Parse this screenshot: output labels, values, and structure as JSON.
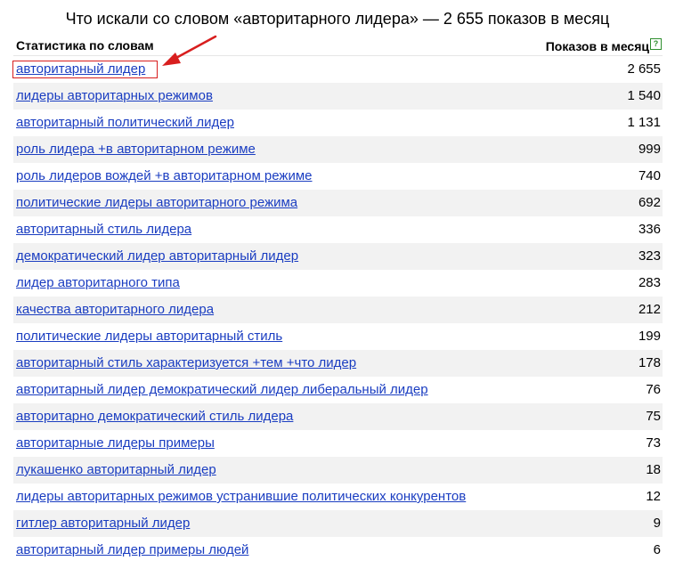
{
  "page": {
    "title": "Что искали со словом «авторитарного лидера» — 2 655 показов в месяц"
  },
  "table": {
    "keyword_header": "Статистика по словам",
    "count_header": "Показов в месяц",
    "help_icon_glyph": "?",
    "help_icon_name": "help-icon",
    "link_color": "#1a3dc1",
    "stripe_color": "#f2f2f2",
    "rows": [
      {
        "keyword": "авторитарный лидер",
        "count": "2 655"
      },
      {
        "keyword": "лидеры авторитарных режимов",
        "count": "1 540"
      },
      {
        "keyword": "авторитарный политический лидер",
        "count": "1 131"
      },
      {
        "keyword": "роль лидера +в авторитарном режиме",
        "count": "999"
      },
      {
        "keyword": "роль лидеров вождей +в авторитарном режиме",
        "count": "740"
      },
      {
        "keyword": "политические лидеры авторитарного режима",
        "count": "692"
      },
      {
        "keyword": "авторитарный стиль лидера",
        "count": "336"
      },
      {
        "keyword": "демократический лидер авторитарный лидер",
        "count": "323"
      },
      {
        "keyword": "лидер авторитарного типа",
        "count": "283"
      },
      {
        "keyword": "качества авторитарного лидера",
        "count": "212"
      },
      {
        "keyword": "политические лидеры авторитарный стиль",
        "count": "199"
      },
      {
        "keyword": "авторитарный стиль характеризуется +тем +что лидер",
        "count": "178"
      },
      {
        "keyword": "авторитарный лидер демократический лидер либеральный лидер",
        "count": "76"
      },
      {
        "keyword": "авторитарно демократический стиль лидера",
        "count": "75"
      },
      {
        "keyword": "авторитарные лидеры примеры",
        "count": "73"
      },
      {
        "keyword": "лукашенко авторитарный лидер",
        "count": "18"
      },
      {
        "keyword": "лидеры авторитарных режимов устранившие политических конкурентов",
        "count": "12"
      },
      {
        "keyword": "гитлер авторитарный лидер",
        "count": "9"
      },
      {
        "keyword": "авторитарный лидер примеры людей",
        "count": "6"
      }
    ]
  },
  "annotation": {
    "highlight_color": "#d81e1e",
    "arrow_name": "red-arrow-annotation"
  }
}
